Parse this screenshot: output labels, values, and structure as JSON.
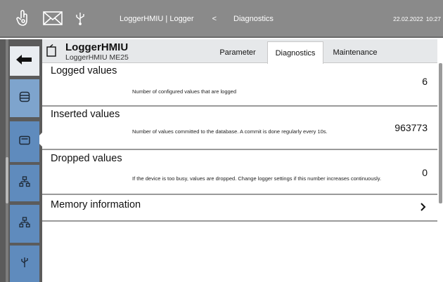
{
  "topbar": {
    "icons": [
      "user-hand-icon",
      "mail-icon",
      "usb-icon"
    ],
    "breadcrumb": {
      "app": "LoggerHMIU | Logger",
      "separator": "<",
      "page": "Diagnostics"
    },
    "date": "22.02.2022",
    "time": "10:27"
  },
  "sidebar": {
    "items": [
      {
        "icon": "back-arrow-icon",
        "state": "back"
      },
      {
        "icon": "database-icon",
        "state": "active"
      },
      {
        "icon": "card-icon",
        "state": "normal"
      },
      {
        "icon": "network-icon",
        "state": "normal"
      },
      {
        "icon": "network-icon",
        "state": "normal"
      },
      {
        "icon": "usb-icon",
        "state": "normal"
      }
    ]
  },
  "device": {
    "name": "LoggerHMIU",
    "model": "LoggerHMIU ME25",
    "icon": "device-icon"
  },
  "tabs": [
    {
      "label": "Parameter",
      "active": false
    },
    {
      "label": "Diagnostics",
      "active": true
    },
    {
      "label": "Maintenance",
      "active": false
    }
  ],
  "rows": [
    {
      "title": "Logged values",
      "description": "Number of configured values that are logged",
      "value": "6"
    },
    {
      "title": "Inserted values",
      "description": "Number of values committed to the database. A commit is done regularly every 10s.",
      "value": "963773"
    },
    {
      "title": "Dropped values",
      "description": "If the device is too busy, values are dropped. Change logger settings if this number increases continuously.",
      "value": "0"
    },
    {
      "title": "Memory information",
      "chevron": ">"
    }
  ],
  "colors": {
    "topbar": "#8a8a8a",
    "sidebar": "#5b5b5b",
    "nav_button": "#5f8bbd",
    "nav_active": "#7ea4cd",
    "header": "#e6e8ea"
  }
}
